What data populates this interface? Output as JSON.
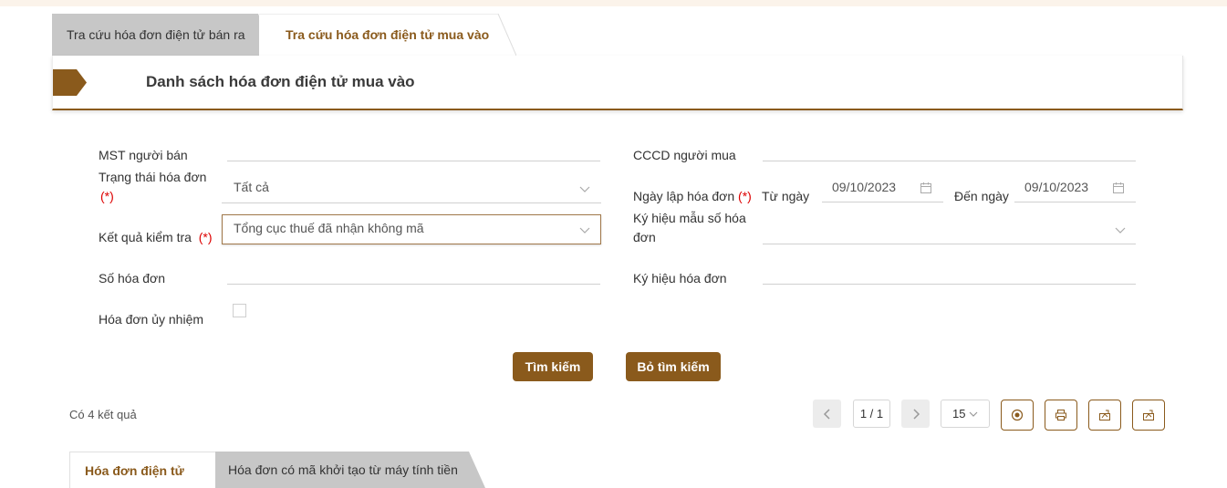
{
  "top_tabs": {
    "tab_sold": "Tra cứu hóa đơn điện tử bán ra",
    "tab_purchased": "Tra cứu hóa đơn điện tử mua vào"
  },
  "section": {
    "title": "Danh sách hóa đơn điện tử mua vào"
  },
  "form": {
    "mst_seller_label": "MST người bán",
    "mst_seller_value": "",
    "cccd_buyer_label": "CCCD người mua",
    "cccd_buyer_value": "",
    "invoice_status_label": "Trạng thái hóa đơn",
    "invoice_status_value": "Tất cả",
    "required_mark": "(*)",
    "issue_date_label": "Ngày lập hóa đơn",
    "from_date_label": "Từ ngày",
    "from_date_value": "09/10/2023",
    "to_date_label": "Đến ngày",
    "to_date_value": "09/10/2023",
    "check_result_label": "Kết quả kiểm tra",
    "check_result_value": "Tổng cục thuế đã nhận không mã",
    "template_symbol_label_line1": "Ký hiệu mẫu số hóa",
    "template_symbol_label_line2": "đơn",
    "template_symbol_value": "",
    "invoice_number_label": "Số hóa đơn",
    "invoice_number_value": "",
    "invoice_symbol_label": "Ký hiệu hóa đơn",
    "invoice_symbol_value": "",
    "authorized_invoice_label": "Hóa đơn ủy nhiệm",
    "authorized_invoice_checked": false
  },
  "actions": {
    "search": "Tìm kiếm",
    "clear_search": "Bỏ tìm kiếm"
  },
  "results": {
    "count_text": "Có 4 kết quả",
    "page_info": "1 / 1",
    "page_size": "15"
  },
  "bottom_tabs": {
    "tab_electronic": "Hóa đơn điện tử",
    "tab_cash_register": "Hóa đơn có mã khởi tạo từ máy tính tiền"
  },
  "colors": {
    "accent": "#8a5a1c",
    "required": "#dd0000",
    "tab_inactive": "#c7c7c7"
  }
}
